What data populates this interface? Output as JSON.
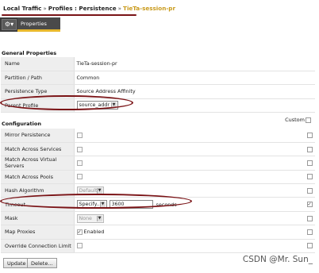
{
  "breadcrumb": {
    "items": [
      "Local Traffic",
      "Profiles : Persistence"
    ],
    "separator": "»",
    "current": "TieTa-session-pr"
  },
  "tabs": {
    "menu_icon": "gear-icon",
    "active_label": "Properties"
  },
  "general": {
    "title": "General Properties",
    "rows": [
      {
        "label": "Name",
        "value": "TieTa-session-pr"
      },
      {
        "label": "Partition / Path",
        "value": "Common"
      },
      {
        "label": "Persistence Type",
        "value": "Source Address Affinity"
      },
      {
        "label": "Parent Profile",
        "value": "source_addr"
      }
    ]
  },
  "configuration": {
    "title": "Configuration",
    "custom_label": "Custom",
    "rows": [
      {
        "label": "Mirror Persistence"
      },
      {
        "label": "Match Across Services"
      },
      {
        "label": "Match Across Virtual Servers"
      },
      {
        "label": "Match Across Pools"
      },
      {
        "label": "Hash Algorithm",
        "value": "Default"
      },
      {
        "label": "Timeout",
        "select": "Specify...",
        "input": "3600",
        "unit": "seconds"
      },
      {
        "label": "Mask",
        "value": "None"
      },
      {
        "label": "Map Proxies",
        "value": "Enabled"
      },
      {
        "label": "Override Connection Limit"
      }
    ]
  },
  "buttons": {
    "update": "Update",
    "delete": "Delete..."
  },
  "watermark": "CSDN @Mr. Sun_",
  "colors": {
    "accent": "#e8b82c",
    "annotation": "#7a1316",
    "breadcrumb_current": "#c99a1a"
  }
}
